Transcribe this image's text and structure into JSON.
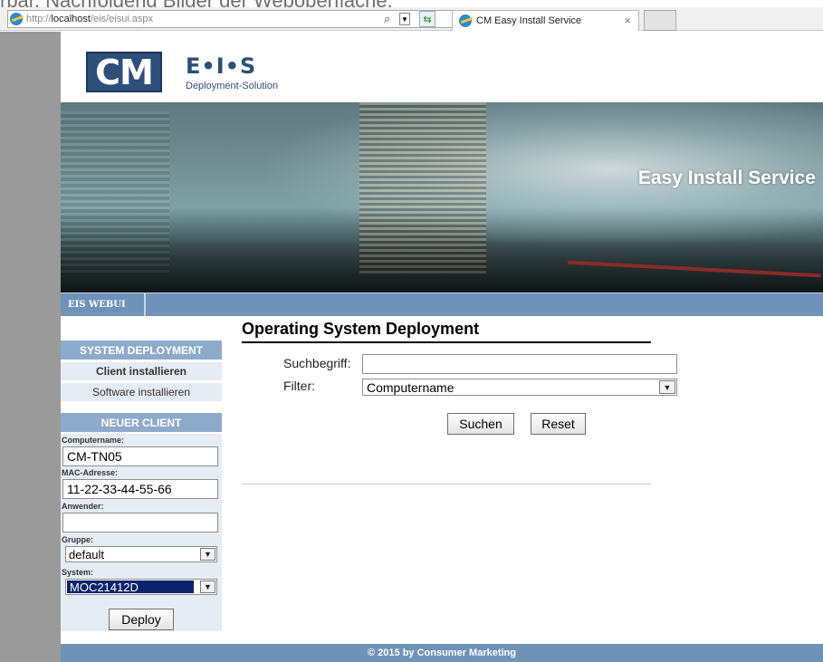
{
  "caption": "rbar. Nachfolgend Bilder der Weboberfläche.",
  "browser": {
    "address_prefix": "http://",
    "address_host": "localhost",
    "address_path": "/eis/eisui.aspx",
    "search_glyph": "⌕",
    "tab_title": "CM Easy Install Service",
    "tab_close": "×"
  },
  "header": {
    "logo_text": "CM",
    "brand": "E•I•S",
    "brand_sub": "Deployment-Solution",
    "banner_title": "Easy Install Service"
  },
  "nav": {
    "item": "EIS WEBUI"
  },
  "sidebar": {
    "section1_title": "SYSTEM DEPLOYMENT",
    "links": [
      "Client installieren",
      "Software installieren"
    ],
    "section2_title": "NEUER CLIENT",
    "fields": {
      "computername_label": "Computername:",
      "computername_value": "CM-TN05",
      "mac_label": "MAC-Adresse:",
      "mac_value": "11-22-33-44-55-66",
      "user_label": "Anwender:",
      "user_value": "",
      "group_label": "Gruppe:",
      "group_value": "default",
      "system_label": "System:",
      "system_value": "MOC21412D"
    },
    "deploy_label": "Deploy"
  },
  "main": {
    "title": "Operating System Deployment",
    "search_label": "Suchbegriff:",
    "search_value": "",
    "filter_label": "Filter:",
    "filter_value": "Computername",
    "search_button": "Suchen",
    "reset_button": "Reset"
  },
  "footer": {
    "text": "© 2015 by Consumer Marketing"
  }
}
